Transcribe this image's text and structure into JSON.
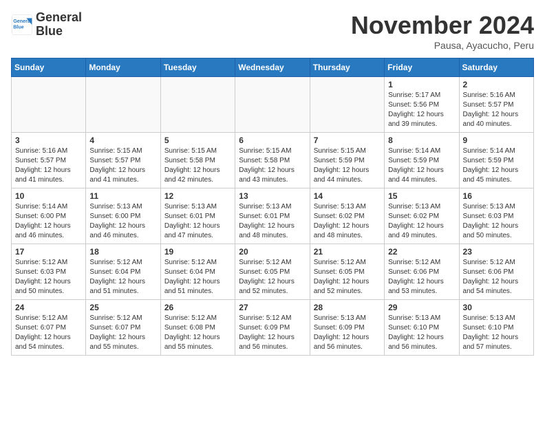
{
  "header": {
    "logo_line1": "General",
    "logo_line2": "Blue",
    "month_title": "November 2024",
    "subtitle": "Pausa, Ayacucho, Peru"
  },
  "days_of_week": [
    "Sunday",
    "Monday",
    "Tuesday",
    "Wednesday",
    "Thursday",
    "Friday",
    "Saturday"
  ],
  "weeks": [
    [
      {
        "day": "",
        "empty": true
      },
      {
        "day": "",
        "empty": true
      },
      {
        "day": "",
        "empty": true
      },
      {
        "day": "",
        "empty": true
      },
      {
        "day": "",
        "empty": true
      },
      {
        "day": "1",
        "sunrise": "5:17 AM",
        "sunset": "5:56 PM",
        "daylight": "12 hours and 39 minutes."
      },
      {
        "day": "2",
        "sunrise": "5:16 AM",
        "sunset": "5:57 PM",
        "daylight": "12 hours and 40 minutes."
      }
    ],
    [
      {
        "day": "3",
        "sunrise": "5:16 AM",
        "sunset": "5:57 PM",
        "daylight": "12 hours and 41 minutes."
      },
      {
        "day": "4",
        "sunrise": "5:15 AM",
        "sunset": "5:57 PM",
        "daylight": "12 hours and 41 minutes."
      },
      {
        "day": "5",
        "sunrise": "5:15 AM",
        "sunset": "5:58 PM",
        "daylight": "12 hours and 42 minutes."
      },
      {
        "day": "6",
        "sunrise": "5:15 AM",
        "sunset": "5:58 PM",
        "daylight": "12 hours and 43 minutes."
      },
      {
        "day": "7",
        "sunrise": "5:15 AM",
        "sunset": "5:59 PM",
        "daylight": "12 hours and 44 minutes."
      },
      {
        "day": "8",
        "sunrise": "5:14 AM",
        "sunset": "5:59 PM",
        "daylight": "12 hours and 44 minutes."
      },
      {
        "day": "9",
        "sunrise": "5:14 AM",
        "sunset": "5:59 PM",
        "daylight": "12 hours and 45 minutes."
      }
    ],
    [
      {
        "day": "10",
        "sunrise": "5:14 AM",
        "sunset": "6:00 PM",
        "daylight": "12 hours and 46 minutes."
      },
      {
        "day": "11",
        "sunrise": "5:13 AM",
        "sunset": "6:00 PM",
        "daylight": "12 hours and 46 minutes."
      },
      {
        "day": "12",
        "sunrise": "5:13 AM",
        "sunset": "6:01 PM",
        "daylight": "12 hours and 47 minutes."
      },
      {
        "day": "13",
        "sunrise": "5:13 AM",
        "sunset": "6:01 PM",
        "daylight": "12 hours and 48 minutes."
      },
      {
        "day": "14",
        "sunrise": "5:13 AM",
        "sunset": "6:02 PM",
        "daylight": "12 hours and 48 minutes."
      },
      {
        "day": "15",
        "sunrise": "5:13 AM",
        "sunset": "6:02 PM",
        "daylight": "12 hours and 49 minutes."
      },
      {
        "day": "16",
        "sunrise": "5:13 AM",
        "sunset": "6:03 PM",
        "daylight": "12 hours and 50 minutes."
      }
    ],
    [
      {
        "day": "17",
        "sunrise": "5:12 AM",
        "sunset": "6:03 PM",
        "daylight": "12 hours and 50 minutes."
      },
      {
        "day": "18",
        "sunrise": "5:12 AM",
        "sunset": "6:04 PM",
        "daylight": "12 hours and 51 minutes."
      },
      {
        "day": "19",
        "sunrise": "5:12 AM",
        "sunset": "6:04 PM",
        "daylight": "12 hours and 51 minutes."
      },
      {
        "day": "20",
        "sunrise": "5:12 AM",
        "sunset": "6:05 PM",
        "daylight": "12 hours and 52 minutes."
      },
      {
        "day": "21",
        "sunrise": "5:12 AM",
        "sunset": "6:05 PM",
        "daylight": "12 hours and 52 minutes."
      },
      {
        "day": "22",
        "sunrise": "5:12 AM",
        "sunset": "6:06 PM",
        "daylight": "12 hours and 53 minutes."
      },
      {
        "day": "23",
        "sunrise": "5:12 AM",
        "sunset": "6:06 PM",
        "daylight": "12 hours and 54 minutes."
      }
    ],
    [
      {
        "day": "24",
        "sunrise": "5:12 AM",
        "sunset": "6:07 PM",
        "daylight": "12 hours and 54 minutes."
      },
      {
        "day": "25",
        "sunrise": "5:12 AM",
        "sunset": "6:07 PM",
        "daylight": "12 hours and 55 minutes."
      },
      {
        "day": "26",
        "sunrise": "5:12 AM",
        "sunset": "6:08 PM",
        "daylight": "12 hours and 55 minutes."
      },
      {
        "day": "27",
        "sunrise": "5:12 AM",
        "sunset": "6:09 PM",
        "daylight": "12 hours and 56 minutes."
      },
      {
        "day": "28",
        "sunrise": "5:13 AM",
        "sunset": "6:09 PM",
        "daylight": "12 hours and 56 minutes."
      },
      {
        "day": "29",
        "sunrise": "5:13 AM",
        "sunset": "6:10 PM",
        "daylight": "12 hours and 56 minutes."
      },
      {
        "day": "30",
        "sunrise": "5:13 AM",
        "sunset": "6:10 PM",
        "daylight": "12 hours and 57 minutes."
      }
    ]
  ]
}
